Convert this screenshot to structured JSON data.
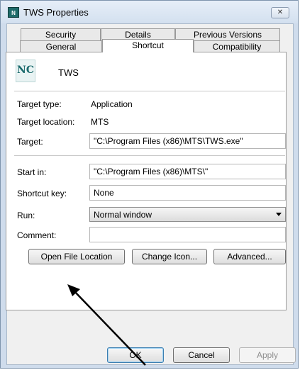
{
  "window": {
    "title": "TWS Properties",
    "close_glyph": "✕",
    "app_icon_text": "N"
  },
  "tabs": {
    "row1": [
      "Security",
      "Details",
      "Previous Versions"
    ],
    "row2": [
      "General",
      "Shortcut",
      "Compatibility"
    ],
    "active": "Shortcut"
  },
  "shortcut": {
    "logo_text": "NC",
    "app_name": "TWS",
    "target_type_label": "Target type:",
    "target_type_value": "Application",
    "target_location_label": "Target location:",
    "target_location_value": "MTS",
    "target_label": "Target:",
    "target_value": "\"C:\\Program Files (x86)\\MTS\\TWS.exe\"",
    "start_in_label": "Start in:",
    "start_in_value": "\"C:\\Program Files (x86)\\MTS\\\"",
    "shortcut_key_label": "Shortcut key:",
    "shortcut_key_value": "None",
    "run_label": "Run:",
    "run_value": "Normal window",
    "comment_label": "Comment:",
    "comment_value": "",
    "buttons": {
      "open_file_location": "Open File Location",
      "change_icon": "Change Icon...",
      "advanced": "Advanced..."
    }
  },
  "footer": {
    "ok": "OK",
    "cancel": "Cancel",
    "apply": "Apply"
  },
  "icons": {
    "app": "tws-app-icon",
    "close": "close-icon",
    "dropdown": "chevron-down-icon",
    "annotation": "arrow-annotation"
  }
}
